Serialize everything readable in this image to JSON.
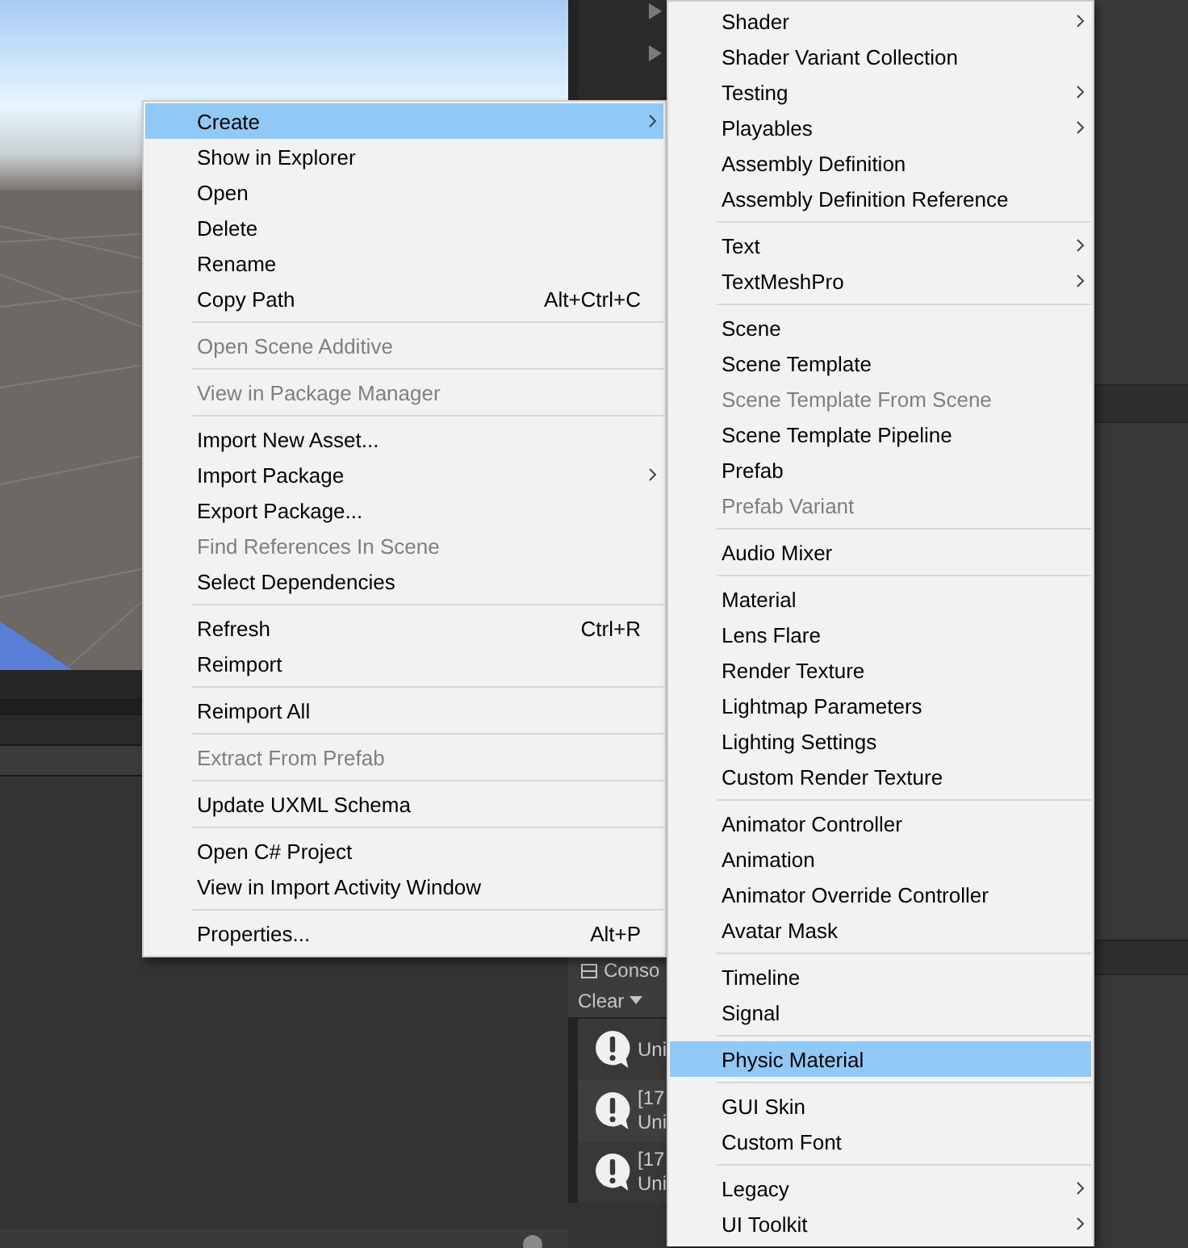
{
  "context_menu": {
    "items": [
      {
        "kind": "item",
        "label": "Create",
        "submenu": true,
        "disabled": false,
        "selected": true
      },
      {
        "kind": "item",
        "label": "Show in Explorer",
        "submenu": false,
        "disabled": false,
        "selected": false
      },
      {
        "kind": "item",
        "label": "Open",
        "submenu": false,
        "disabled": false,
        "selected": false
      },
      {
        "kind": "item",
        "label": "Delete",
        "submenu": false,
        "disabled": false,
        "selected": false
      },
      {
        "kind": "item",
        "label": "Rename",
        "submenu": false,
        "disabled": false,
        "selected": false
      },
      {
        "kind": "item",
        "label": "Copy Path",
        "shortcut": "Alt+Ctrl+C",
        "submenu": false,
        "disabled": false,
        "selected": false
      },
      {
        "kind": "separator"
      },
      {
        "kind": "item",
        "label": "Open Scene Additive",
        "submenu": false,
        "disabled": true,
        "selected": false
      },
      {
        "kind": "separator"
      },
      {
        "kind": "item",
        "label": "View in Package Manager",
        "submenu": false,
        "disabled": true,
        "selected": false
      },
      {
        "kind": "separator"
      },
      {
        "kind": "item",
        "label": "Import New Asset...",
        "submenu": false,
        "disabled": false,
        "selected": false
      },
      {
        "kind": "item",
        "label": "Import Package",
        "submenu": true,
        "disabled": false,
        "selected": false
      },
      {
        "kind": "item",
        "label": "Export Package...",
        "submenu": false,
        "disabled": false,
        "selected": false
      },
      {
        "kind": "item",
        "label": "Find References In Scene",
        "submenu": false,
        "disabled": true,
        "selected": false
      },
      {
        "kind": "item",
        "label": "Select Dependencies",
        "submenu": false,
        "disabled": false,
        "selected": false
      },
      {
        "kind": "separator"
      },
      {
        "kind": "item",
        "label": "Refresh",
        "shortcut": "Ctrl+R",
        "submenu": false,
        "disabled": false,
        "selected": false
      },
      {
        "kind": "item",
        "label": "Reimport",
        "submenu": false,
        "disabled": false,
        "selected": false
      },
      {
        "kind": "separator"
      },
      {
        "kind": "item",
        "label": "Reimport All",
        "submenu": false,
        "disabled": false,
        "selected": false
      },
      {
        "kind": "separator"
      },
      {
        "kind": "item",
        "label": "Extract From Prefab",
        "submenu": false,
        "disabled": true,
        "selected": false
      },
      {
        "kind": "separator"
      },
      {
        "kind": "item",
        "label": "Update UXML Schema",
        "submenu": false,
        "disabled": false,
        "selected": false
      },
      {
        "kind": "separator"
      },
      {
        "kind": "item",
        "label": "Open C# Project",
        "submenu": false,
        "disabled": false,
        "selected": false
      },
      {
        "kind": "item",
        "label": "View in Import Activity Window",
        "submenu": false,
        "disabled": false,
        "selected": false
      },
      {
        "kind": "separator"
      },
      {
        "kind": "item",
        "label": "Properties...",
        "shortcut": "Alt+P",
        "submenu": false,
        "disabled": false,
        "selected": false
      }
    ]
  },
  "create_submenu": {
    "items": [
      {
        "kind": "item",
        "label": "Shader",
        "submenu": true,
        "disabled": false,
        "selected": false
      },
      {
        "kind": "item",
        "label": "Shader Variant Collection",
        "submenu": false,
        "disabled": false,
        "selected": false
      },
      {
        "kind": "item",
        "label": "Testing",
        "submenu": true,
        "disabled": false,
        "selected": false
      },
      {
        "kind": "item",
        "label": "Playables",
        "submenu": true,
        "disabled": false,
        "selected": false
      },
      {
        "kind": "item",
        "label": "Assembly Definition",
        "submenu": false,
        "disabled": false,
        "selected": false
      },
      {
        "kind": "item",
        "label": "Assembly Definition Reference",
        "submenu": false,
        "disabled": false,
        "selected": false
      },
      {
        "kind": "separator"
      },
      {
        "kind": "item",
        "label": "Text",
        "submenu": true,
        "disabled": false,
        "selected": false
      },
      {
        "kind": "item",
        "label": "TextMeshPro",
        "submenu": true,
        "disabled": false,
        "selected": false
      },
      {
        "kind": "separator"
      },
      {
        "kind": "item",
        "label": "Scene",
        "submenu": false,
        "disabled": false,
        "selected": false
      },
      {
        "kind": "item",
        "label": "Scene Template",
        "submenu": false,
        "disabled": false,
        "selected": false
      },
      {
        "kind": "item",
        "label": "Scene Template From Scene",
        "submenu": false,
        "disabled": true,
        "selected": false
      },
      {
        "kind": "item",
        "label": "Scene Template Pipeline",
        "submenu": false,
        "disabled": false,
        "selected": false
      },
      {
        "kind": "item",
        "label": "Prefab",
        "submenu": false,
        "disabled": false,
        "selected": false
      },
      {
        "kind": "item",
        "label": "Prefab Variant",
        "submenu": false,
        "disabled": true,
        "selected": false
      },
      {
        "kind": "separator"
      },
      {
        "kind": "item",
        "label": "Audio Mixer",
        "submenu": false,
        "disabled": false,
        "selected": false
      },
      {
        "kind": "separator"
      },
      {
        "kind": "item",
        "label": "Material",
        "submenu": false,
        "disabled": false,
        "selected": false
      },
      {
        "kind": "item",
        "label": "Lens Flare",
        "submenu": false,
        "disabled": false,
        "selected": false
      },
      {
        "kind": "item",
        "label": "Render Texture",
        "submenu": false,
        "disabled": false,
        "selected": false
      },
      {
        "kind": "item",
        "label": "Lightmap Parameters",
        "submenu": false,
        "disabled": false,
        "selected": false
      },
      {
        "kind": "item",
        "label": "Lighting Settings",
        "submenu": false,
        "disabled": false,
        "selected": false
      },
      {
        "kind": "item",
        "label": "Custom Render Texture",
        "submenu": false,
        "disabled": false,
        "selected": false
      },
      {
        "kind": "separator"
      },
      {
        "kind": "item",
        "label": "Animator Controller",
        "submenu": false,
        "disabled": false,
        "selected": false
      },
      {
        "kind": "item",
        "label": "Animation",
        "submenu": false,
        "disabled": false,
        "selected": false
      },
      {
        "kind": "item",
        "label": "Animator Override Controller",
        "submenu": false,
        "disabled": false,
        "selected": false
      },
      {
        "kind": "item",
        "label": "Avatar Mask",
        "submenu": false,
        "disabled": false,
        "selected": false
      },
      {
        "kind": "separator"
      },
      {
        "kind": "item",
        "label": "Timeline",
        "submenu": false,
        "disabled": false,
        "selected": false
      },
      {
        "kind": "item",
        "label": "Signal",
        "submenu": false,
        "disabled": false,
        "selected": false
      },
      {
        "kind": "separator"
      },
      {
        "kind": "item",
        "label": "Physic Material",
        "submenu": false,
        "disabled": false,
        "selected": true
      },
      {
        "kind": "separator"
      },
      {
        "kind": "item",
        "label": "GUI Skin",
        "submenu": false,
        "disabled": false,
        "selected": false
      },
      {
        "kind": "item",
        "label": "Custom Font",
        "submenu": false,
        "disabled": false,
        "selected": false
      },
      {
        "kind": "separator"
      },
      {
        "kind": "item",
        "label": "Legacy",
        "submenu": true,
        "disabled": false,
        "selected": false
      },
      {
        "kind": "item",
        "label": "UI Toolkit",
        "submenu": true,
        "disabled": false,
        "selected": false
      }
    ]
  },
  "console": {
    "tab": "Conso",
    "clear_button": "Clear",
    "entries": [
      {
        "lines": [
          "Uni"
        ]
      },
      {
        "lines": [
          "[17",
          "Uni"
        ]
      },
      {
        "lines": [
          "[17",
          "Uni"
        ]
      }
    ]
  }
}
